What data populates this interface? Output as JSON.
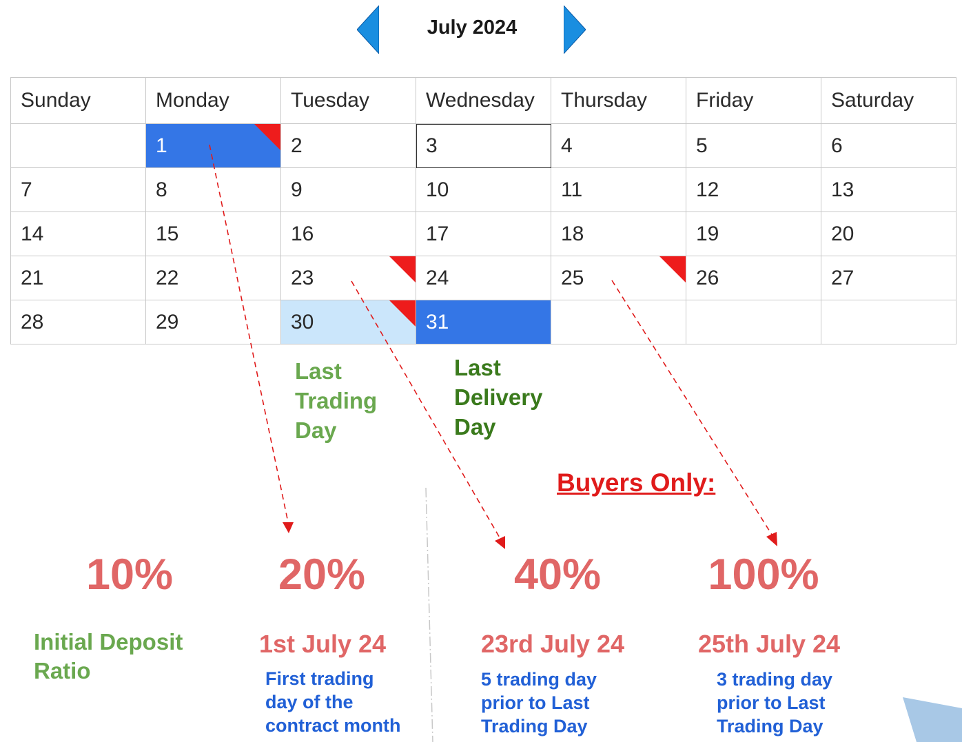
{
  "header": {
    "month_title": "July 2024"
  },
  "calendar": {
    "days": [
      "Sunday",
      "Monday",
      "Tuesday",
      "Wednesday",
      "Thursday",
      "Friday",
      "Saturday"
    ],
    "weeks": [
      [
        "",
        "1",
        "2",
        "3",
        "4",
        "5",
        "6"
      ],
      [
        "7",
        "8",
        "9",
        "10",
        "11",
        "12",
        "13"
      ],
      [
        "14",
        "15",
        "16",
        "17",
        "18",
        "19",
        "20"
      ],
      [
        "21",
        "22",
        "23",
        "24",
        "25",
        "26",
        "27"
      ],
      [
        "28",
        "29",
        "30",
        "31",
        "",
        "",
        ""
      ]
    ],
    "highlight_dark": [
      "1",
      "31"
    ],
    "highlight_light": [
      "30"
    ],
    "today": "3",
    "flagged": [
      "1",
      "23",
      "25",
      "30"
    ],
    "colors": {
      "dark": "#3476e6",
      "light": "#cbe6fb",
      "flag": "#ee1c1c"
    }
  },
  "labels": {
    "last_trading_day": [
      "Last",
      "Trading",
      "Day"
    ],
    "last_delivery_day": [
      "Last",
      "Delivery",
      "Day"
    ],
    "buyers_only": "Buyers Only:"
  },
  "ratios": {
    "deposit": {
      "percent": "10%",
      "label": [
        "Initial Deposit",
        "Ratio"
      ]
    },
    "first": {
      "percent": "20%",
      "date": "1st July 24",
      "desc": [
        "First trading",
        "day of the",
        "contract month"
      ]
    },
    "second": {
      "percent": "40%",
      "date": "23rd July 24",
      "desc": [
        "5 trading day",
        "prior to Last",
        "Trading Day"
      ]
    },
    "third": {
      "percent": "100%",
      "date": "25th July 24",
      "desc": [
        "3 trading day",
        "prior to Last",
        "Trading Day"
      ]
    }
  },
  "colors": {
    "percent": "#e06666",
    "green": "#6aa84f",
    "dark_green": "#3a7a1c",
    "blue_text": "#2160d6",
    "red": "#e01b1b",
    "nav_arrow": "#1a8ee0"
  }
}
